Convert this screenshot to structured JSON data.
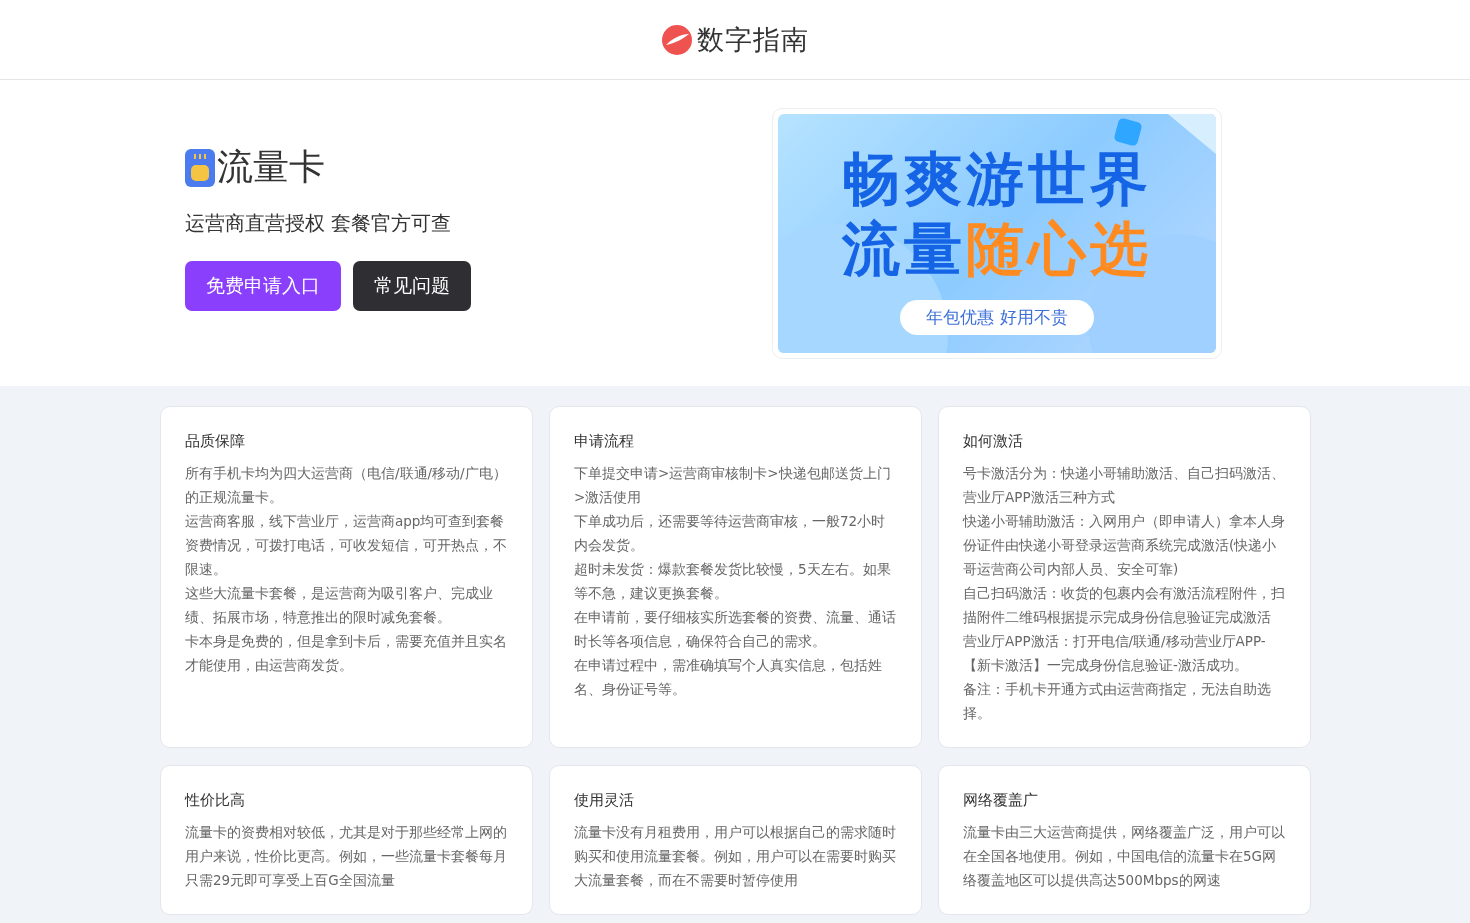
{
  "header": {
    "logo_text": "数字指南"
  },
  "hero": {
    "product_name": "流量卡",
    "tagline": "运营商直营授权 套餐官方可查",
    "buttons": [
      {
        "label": "免费申请入口",
        "kind": "primary"
      },
      {
        "label": "常见问题",
        "kind": "secondary"
      }
    ],
    "banner": {
      "headline_1": "畅爽游世界",
      "headline_2a": "流量",
      "headline_2b": "随心选",
      "pill": "年包优惠 好用不贵"
    }
  },
  "cards": [
    {
      "title": "品质保障",
      "paragraphs": [
        "所有手机卡均为四大运营商（电信/联通/移动/广电）的正规流量卡。",
        "运营商客服，线下营业厅，运营商app均可查到套餐资费情况，可拨打电话，可收发短信，可开热点，不限速。",
        "这些大流量卡套餐，是运营商为吸引客户、完成业绩、拓展市场，特意推出的限时减免套餐。",
        "卡本身是免费的，但是拿到卡后，需要充值并且实名才能使用，由运营商发货。"
      ]
    },
    {
      "title": "申请流程",
      "paragraphs": [
        "下单提交申请>运营商审核制卡>快递包邮送货上门>激活使用",
        "下单成功后，还需要等待运营商审核，一般72小时内会发货。",
        "超时未发货：爆款套餐发货比较慢，5天左右。如果等不急，建议更换套餐。",
        "在申请前，要仔细核实所选套餐的资费、流量、通话时长等各项信息，确保符合自己的需求。",
        "在申请过程中，需准确填写个人真实信息，包括姓名、身份证号等。"
      ]
    },
    {
      "title": "如何激活",
      "paragraphs": [
        "号卡激活分为：快递小哥辅助激活、自己扫码激活、营业厅APP激活三种方式",
        "快递小哥辅助激活：入网用户（即申请人）拿本人身份证件由快递小哥登录运营商系统完成激活(快递小哥运营商公司内部人员、安全可靠)",
        "自己扫码激活：收货的包裹内会有激活流程附件，扫描附件二维码根据提示完成身份信息验证完成激活",
        "营业厅APP激活：打开电信/联通/移动营业厅APP-【新卡激活】一完成身份信息验证-激活成功。",
        "备注：手机卡开通方式由运营商指定，无法自助选择。"
      ]
    },
    {
      "title": "性价比高",
      "paragraphs": [
        "流量卡的资费相对较低，尤其是对于那些经常上网的用户来说，性价比更高。例如，一些流量卡套餐每月只需29元即可享受上百G全国流量"
      ]
    },
    {
      "title": "使用灵活",
      "paragraphs": [
        "流量卡没有月租费用，用户可以根据自己的需求随时购买和使用流量套餐。例如，用户可以在需要时购买大流量套餐，而在不需要时暂停使用"
      ]
    },
    {
      "title": "网络覆盖广",
      "paragraphs": [
        "流量卡由三大运营商提供，网络覆盖广泛，用户可以在全国各地使用。例如，中国电信的流量卡在5G网络覆盖地区可以提供高达500Mbps的网速"
      ]
    }
  ]
}
